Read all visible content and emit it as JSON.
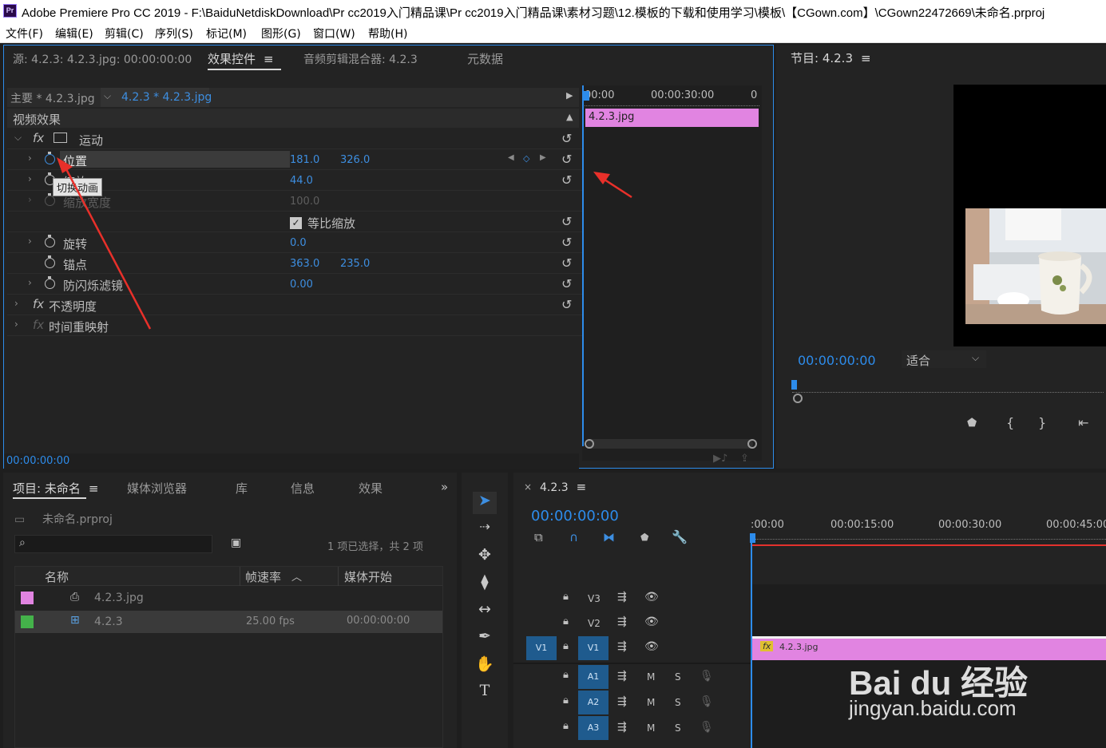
{
  "window": {
    "app_icon": "Pr",
    "title": "Adobe Premiere Pro CC 2019 - F:\\BaiduNetdiskDownload\\Pr cc2019入门精品课\\Pr cc2019入门精品课\\素材习题\\12.模板的下载和使用学习\\模板\\【CGown.com】\\CGown22472669\\未命名.prproj"
  },
  "menu": [
    "文件(F)",
    "编辑(E)",
    "剪辑(C)",
    "序列(S)",
    "标记(M)",
    "图形(G)",
    "窗口(W)",
    "帮助(H)"
  ],
  "source_panel": {
    "tabs": [
      "源: 4.2.3: 4.2.3.jpg: 00:00:00:00",
      "效果控件",
      "音频剪辑混合器: 4.2.3",
      "元数据"
    ],
    "active_tab": 1,
    "clip_master": "主要 * 4.2.3.jpg",
    "clip_sequence": "4.2.3 * 4.2.3.jpg",
    "section_video": "视频效果",
    "motion": "运动",
    "properties": {
      "position": {
        "label": "位置",
        "x": "181.0",
        "y": "326.0"
      },
      "scale": {
        "label": "缩放",
        "value": "44.0"
      },
      "scale_width": {
        "label": "缩放宽度",
        "value": "100.0"
      },
      "uniform_scale": "等比缩放",
      "rotation": {
        "label": "旋转",
        "value": "0.0"
      },
      "anchor": {
        "label": "锚点",
        "x": "363.0",
        "y": "235.0"
      },
      "antiflicker": {
        "label": "防闪烁滤镜",
        "value": "0.00"
      }
    },
    "opacity": "不透明度",
    "time_remap": "时间重映射",
    "tooltip": "切换动画",
    "mini_ruler": [
      "00:00",
      "00:00:30:00",
      "0"
    ],
    "clip_bar_label": "4.2.3.jpg",
    "timecode": "00:00:00:00"
  },
  "program_panel": {
    "title": "节目: 4.2.3",
    "timecode": "00:00:00:00",
    "fit_label": "适合"
  },
  "project_panel": {
    "tabs": [
      "项目: 未命名",
      "媒体浏览器",
      "库",
      "信息",
      "效果"
    ],
    "project_file": "未命名.prproj",
    "selection_info": "1 项已选择，共 2 项",
    "columns": [
      "名称",
      "帧速率",
      "媒体开始"
    ],
    "rows": [
      {
        "name": "4.2.3.jpg",
        "fps": "",
        "start": "",
        "color": "#e184e1"
      },
      {
        "name": "4.2.3",
        "fps": "25.00 fps",
        "start": "00:00:00:00",
        "color": "#44b24a"
      }
    ]
  },
  "timeline_panel": {
    "title": "4.2.3",
    "timecode": "00:00:00:00",
    "ruler": [
      ":00:00",
      "00:00:15:00",
      "00:00:30:00",
      "00:00:45:00"
    ],
    "video_tracks": [
      "V3",
      "V2",
      "V1"
    ],
    "source_patch": "V1",
    "audio_tracks": [
      "A1",
      "A2",
      "A3"
    ],
    "mute_label": "M",
    "solo_label": "S",
    "clip_label": "4.2.3.jpg",
    "fx_badge": "fx"
  },
  "watermark": {
    "brand": "Bai du 经验",
    "url": "jingyan.baidu.com"
  },
  "colors": {
    "accent": "#2d8ceb",
    "clip_pink": "#e184e1",
    "value_blue": "#3d8ee0",
    "playhead": "#2d8ceb",
    "annotation_red": "#e8302a"
  }
}
